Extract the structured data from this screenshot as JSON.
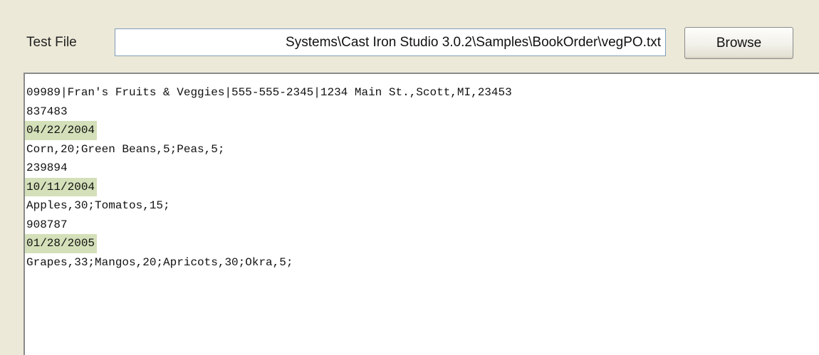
{
  "colors": {
    "window_background": "#ece9d8",
    "highlight": "#d4e0b9",
    "field_border": "#7f9db9"
  },
  "file_row": {
    "label": "Test File",
    "path_value": "Systems\\Cast Iron Studio 3.0.2\\Samples\\BookOrder\\vegPO.txt",
    "browse_label": "Browse"
  },
  "content": {
    "lines": [
      {
        "text": "09989|Fran's Fruits & Veggies|555-555-2345|1234 Main St.,Scott,MI,23453",
        "highlighted": false
      },
      {
        "text": "837483",
        "highlighted": false
      },
      {
        "text": "04/22/2004",
        "highlighted": true
      },
      {
        "text": "Corn,20;Green Beans,5;Peas,5;",
        "highlighted": false
      },
      {
        "text": "239894",
        "highlighted": false
      },
      {
        "text": "10/11/2004",
        "highlighted": true
      },
      {
        "text": "Apples,30;Tomatos,15;",
        "highlighted": false
      },
      {
        "text": "908787",
        "highlighted": false
      },
      {
        "text": "01/28/2005",
        "highlighted": true
      },
      {
        "text": "Grapes,33;Mangos,20;Apricots,30;Okra,5;",
        "highlighted": false
      }
    ]
  }
}
